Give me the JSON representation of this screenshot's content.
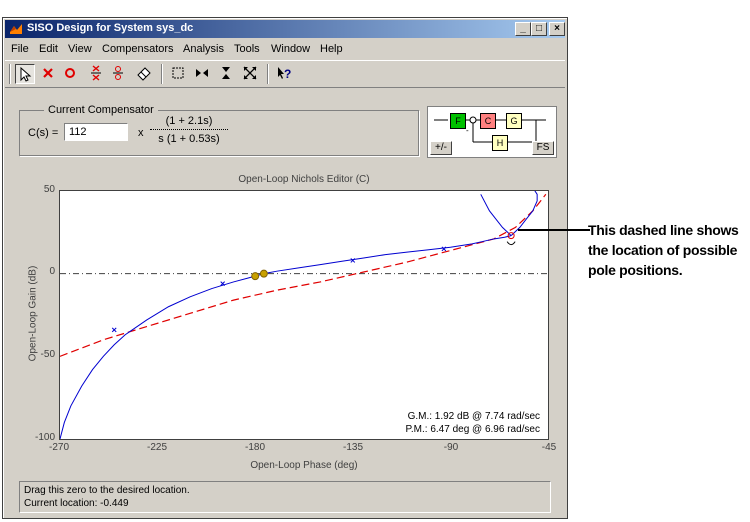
{
  "window": {
    "title": "SISO Design for System sys_dc",
    "controls": {
      "minimize": "_",
      "maximize": "□",
      "close": "×"
    }
  },
  "menu": [
    "File",
    "Edit",
    "View",
    "Compensators",
    "Analysis",
    "Tools",
    "Window",
    "Help"
  ],
  "toolbar": {
    "icons": [
      "arrow-select-icon",
      "add-pole-icon",
      "add-zero-icon",
      "add-complex-pole-icon",
      "add-complex-zero-icon",
      "erase-icon",
      "zoom-box-icon",
      "zoom-x-icon",
      "zoom-y-icon",
      "fit-icon",
      "help-icon"
    ],
    "colors": {
      "pole": "#e00000",
      "zero": "#e00000"
    }
  },
  "compensator": {
    "legend": "Current Compensator",
    "label": "C(s) =",
    "gain": "112",
    "times": "x",
    "numerator": "(1 + 2.1s)",
    "denominator": "s (1 + 0.53s)"
  },
  "diagram": {
    "blocks": {
      "f": "F",
      "c": "C",
      "g": "G",
      "h": "H"
    },
    "sign_button": "+/-",
    "fs_button": "FS",
    "colors": {
      "f": "#00c000",
      "c": "#ff8080",
      "g": "#ffffc0",
      "h": "#ffffc0"
    }
  },
  "plot": {
    "title": "Open-Loop Nichols Editor (C)",
    "xlabel": "Open-Loop Phase (deg)",
    "ylabel": "Open-Loop Gain (dB)",
    "xticks": [
      "-270",
      "-225",
      "-180",
      "-135",
      "-90",
      "-45"
    ],
    "yticks": [
      "50",
      "0",
      "-50",
      "-100"
    ],
    "gm": "G.M.: 1.92 dB @ 7.74 rad/sec",
    "pm": "P.M.: 6.47 deg @ 6.96 rad/sec",
    "colors": {
      "nichols": "#0000d0",
      "pole_path": "#e00000",
      "marker": "#c8a000"
    }
  },
  "status": {
    "line1": "Drag this zero to the desired location.",
    "line2": "Current location: -0.449"
  },
  "annotation": {
    "line1": "This dashed line shows",
    "line2": "the location of possible",
    "line3": "pole positions."
  },
  "chart_data": {
    "type": "line",
    "title": "Open-Loop Nichols Editor (C)",
    "xlabel": "Open-Loop Phase (deg)",
    "ylabel": "Open-Loop Gain (dB)",
    "xlim": [
      -270,
      -45
    ],
    "ylim": [
      -100,
      50
    ],
    "series": [
      {
        "x": [
          -270,
          -268,
          -265,
          -260,
          -255,
          -250,
          -245,
          -240,
          -230,
          -220,
          -210,
          -200,
          -190,
          -180,
          -176,
          -170,
          -160,
          -150,
          -140,
          -130,
          -120,
          -110,
          -100,
          -90,
          -80,
          -75,
          -70,
          -65,
          -62
        ],
        "y": [
          -100,
          -90,
          -80,
          -68,
          -58,
          -50,
          -43,
          -37,
          -28,
          -20,
          -14,
          -9,
          -5,
          -1.5,
          0,
          1.5,
          3.5,
          5.5,
          7.5,
          9.5,
          11.5,
          13,
          14.5,
          16,
          18,
          19.5,
          21,
          22,
          23
        ]
      },
      {
        "x": [
          -62,
          -58,
          -55,
          -52,
          -50,
          -50,
          -52,
          -56,
          -60
        ],
        "y": [
          23,
          28,
          33,
          38,
          44,
          48,
          52,
          54,
          56
        ]
      },
      {
        "x": [
          -62,
          -66,
          -72,
          -76
        ],
        "y": [
          23,
          28,
          38,
          48
        ]
      }
    ],
    "dashed": {
      "x": [
        -270,
        -250,
        -230,
        -210,
        -190,
        -170,
        -150,
        -130,
        -110,
        -90,
        -70,
        -60,
        -52,
        -46
      ],
      "y": [
        -50,
        -40,
        -32,
        -24,
        -16,
        -10,
        -5,
        1,
        7,
        14,
        21,
        28,
        38,
        48
      ]
    }
  }
}
